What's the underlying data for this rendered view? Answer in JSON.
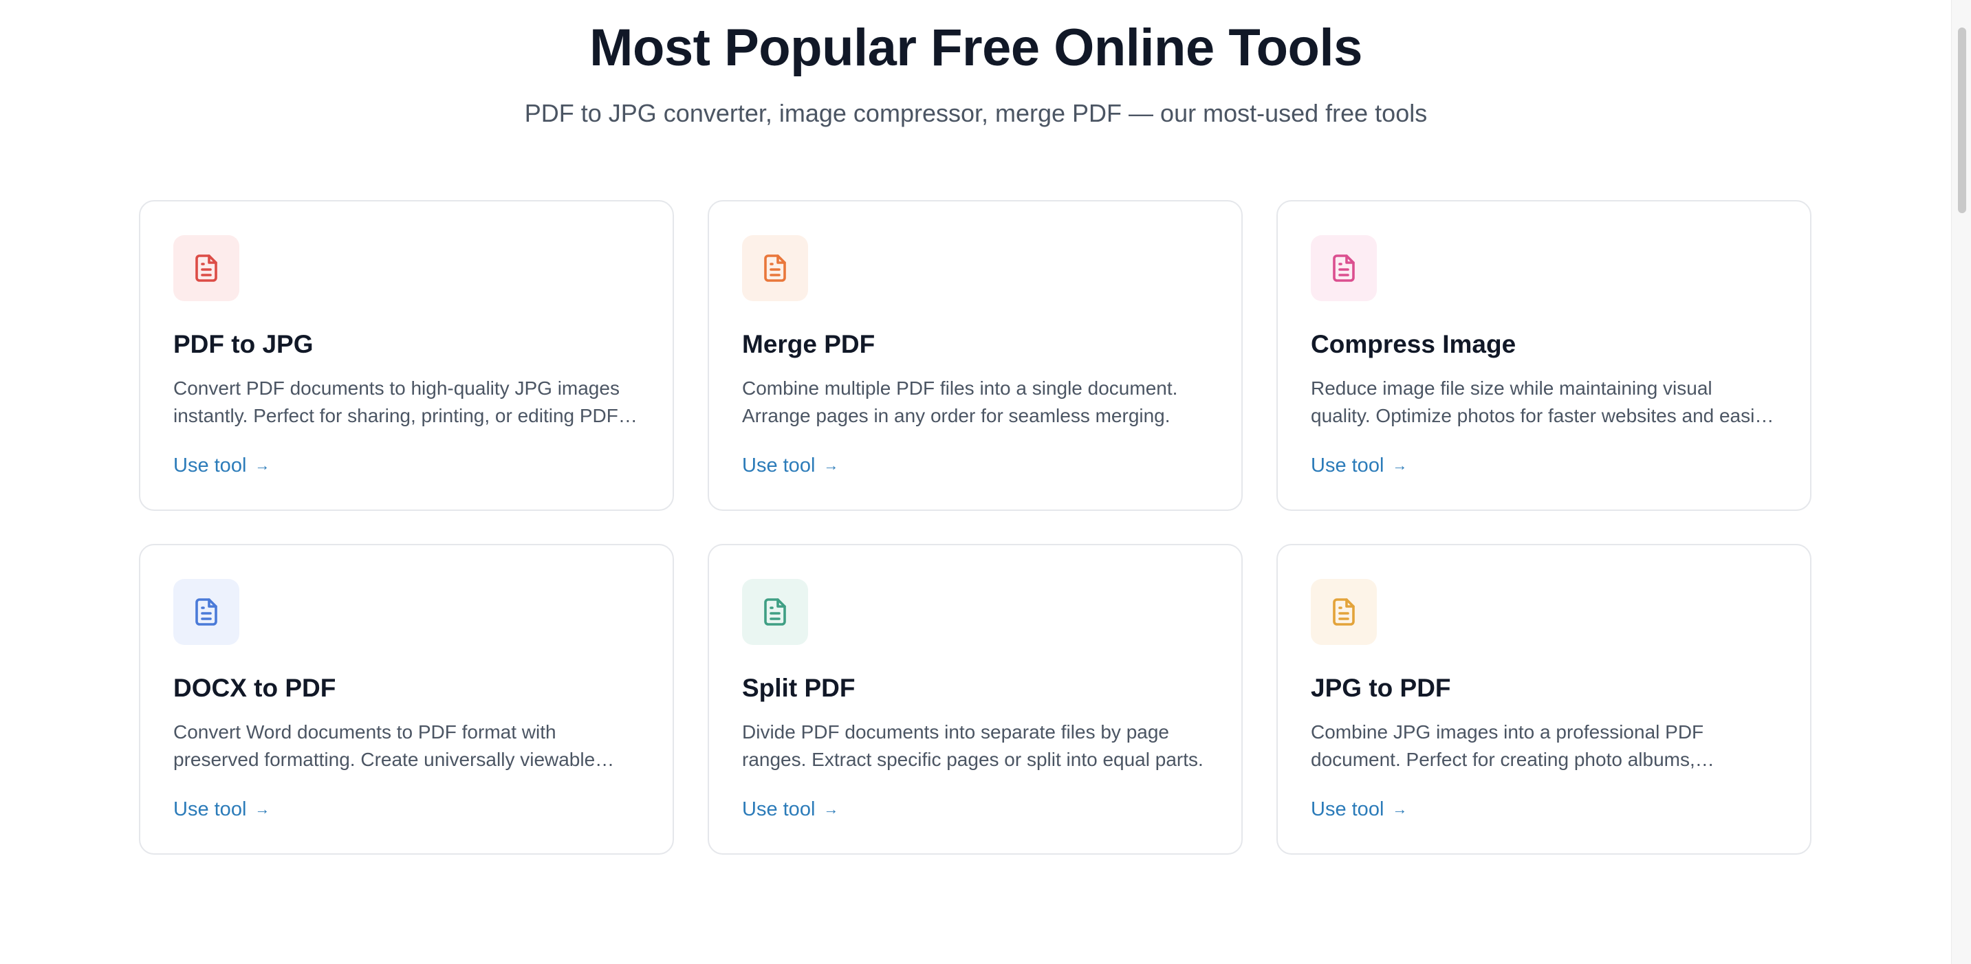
{
  "header": {
    "title": "Most Popular Free Online Tools",
    "subtitle": "PDF to JPG converter, image compressor, merge PDF — our most-used free tools"
  },
  "tools": [
    {
      "title": "PDF to JPG",
      "description": "Convert PDF documents to high-quality JPG images instantly. Perfect for sharing, printing, or editing PDF pages as images.",
      "link_label": "Use tool",
      "link_arrow": "→",
      "icon": "document-icon",
      "icon_color": "#dc4c46",
      "tile_color": "#fdecec"
    },
    {
      "title": "Merge PDF",
      "description": "Combine multiple PDF files into a single document. Arrange pages in any order for seamless merging.",
      "link_label": "Use tool",
      "link_arrow": "→",
      "icon": "document-icon",
      "icon_color": "#e9773b",
      "tile_color": "#fdf1e9"
    },
    {
      "title": "Compress Image",
      "description": "Reduce image file size while maintaining visual quality. Optimize photos for faster websites and easier sharing.",
      "link_label": "Use tool",
      "link_arrow": "→",
      "icon": "document-icon",
      "icon_color": "#db4f8f",
      "tile_color": "#fdedf4"
    },
    {
      "title": "DOCX to PDF",
      "description": "Convert Word documents to PDF format with preserved formatting. Create universally viewable documents.",
      "link_label": "Use tool",
      "link_arrow": "→",
      "icon": "document-icon",
      "icon_color": "#4a7ad8",
      "tile_color": "#edf2fd"
    },
    {
      "title": "Split PDF",
      "description": "Divide PDF documents into separate files by page ranges. Extract specific pages or split into equal parts.",
      "link_label": "Use tool",
      "link_arrow": "→",
      "icon": "document-icon",
      "icon_color": "#3f9f84",
      "tile_color": "#eaf6f2"
    },
    {
      "title": "JPG to PDF",
      "description": "Combine JPG images into a professional PDF document. Perfect for creating photo albums, portfolios and more.",
      "link_label": "Use tool",
      "link_arrow": "→",
      "icon": "document-icon",
      "icon_color": "#e3a33a",
      "tile_color": "#fdf4e8"
    }
  ],
  "colors": {
    "link": "#2b7bb9",
    "heading": "#111827",
    "body_text": "#4b5563",
    "card_border": "#e5e7eb"
  }
}
